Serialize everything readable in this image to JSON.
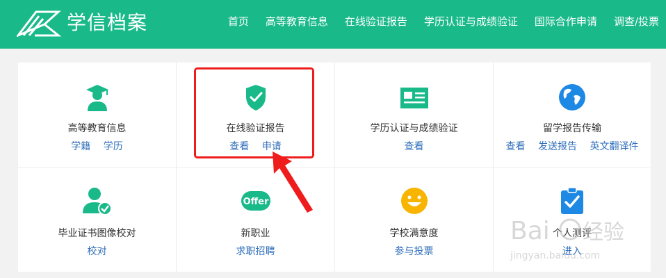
{
  "header": {
    "brand": "学信档案",
    "nav": [
      "首页",
      "高等教育信息",
      "在线验证报告",
      "学历认证与成绩验证",
      "国际合作申请",
      "调查/投票"
    ]
  },
  "cards": [
    {
      "title": "高等教育信息",
      "icon": "graduate-icon",
      "links": [
        "学籍",
        "学历"
      ]
    },
    {
      "title": "在线验证报告",
      "icon": "shield-check-icon",
      "links": [
        "查看",
        "申请"
      ]
    },
    {
      "title": "学历认证与成绩验证",
      "icon": "id-card-icon",
      "links": [
        "查看"
      ]
    },
    {
      "title": "留学报告传输",
      "icon": "globe-icon",
      "links": [
        "查看",
        "发送报告",
        "英文翻译件"
      ]
    },
    {
      "title": "毕业证书图像校对",
      "icon": "user-verified-icon",
      "links": [
        "校对"
      ]
    },
    {
      "title": "新职业",
      "icon": "offer-badge-icon",
      "links": [
        "求职招聘"
      ],
      "badge": "Offer"
    },
    {
      "title": "学校满意度",
      "icon": "smiley-icon",
      "links": [
        "参与投票"
      ]
    },
    {
      "title": "个人测评",
      "icon": "clipboard-check-icon",
      "links": [
        "进入"
      ]
    }
  ],
  "watermark": {
    "line1": "Bai",
    "line2": "经验",
    "url": "jingyan.baidu.com"
  },
  "colors": {
    "brand": "#19b989",
    "link": "#2f6ebb",
    "highlight": "#ef1c1c",
    "accent_blue": "#1e88e5",
    "smiley": "#f7b500"
  }
}
